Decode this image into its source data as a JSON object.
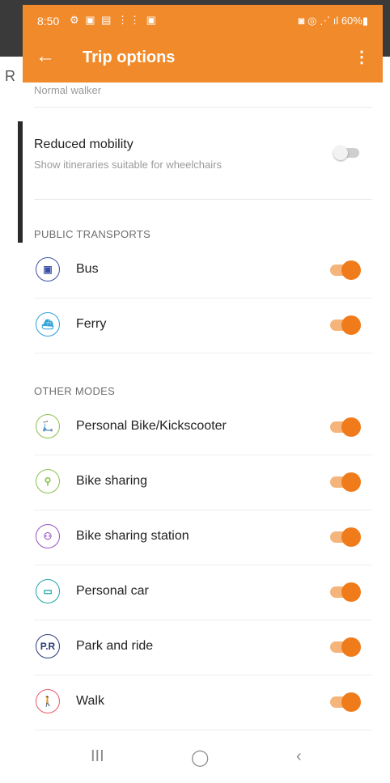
{
  "status_bar": {
    "time": "8:50",
    "left_icons": "⚙ ▣ ▤ ⋮⋮ ▣",
    "right_indicators": "◙ ◎ ⋰ ıl 60%▮"
  },
  "app_bar": {
    "title": "Trip options",
    "background_color": "#f08a2a"
  },
  "behind_app_letter": "R",
  "walker": {
    "label": "Normal walker"
  },
  "reduced_mobility": {
    "title": "Reduced mobility",
    "subtitle": "Show itineraries suitable for wheelchairs",
    "enabled": false
  },
  "public_transports": {
    "header": "PUBLIC TRANSPORTS",
    "items": [
      {
        "label": "Bus",
        "icon": "bus-icon",
        "icon_glyph": "▣",
        "color": "#3b4fa6",
        "enabled": true
      },
      {
        "label": "Ferry",
        "icon": "ferry-icon",
        "icon_glyph": "⛴",
        "color": "#2aa0d8",
        "enabled": true
      }
    ]
  },
  "other_modes": {
    "header": "OTHER MODES",
    "items": [
      {
        "label": "Personal Bike/Kickscooter",
        "icon": "bike-kickscooter-icon",
        "icon_glyph": "🛴",
        "color": "#8cc04a",
        "enabled": true
      },
      {
        "label": "Bike sharing",
        "icon": "bike-sharing-icon",
        "icon_glyph": "⚲",
        "color": "#8cc04a",
        "enabled": true
      },
      {
        "label": "Bike sharing station",
        "icon": "bike-station-icon",
        "icon_glyph": "⚇",
        "color": "#9a4fc4",
        "enabled": true
      },
      {
        "label": "Personal car",
        "icon": "car-icon",
        "icon_glyph": "▭",
        "color": "#1aa6a6",
        "enabled": true
      },
      {
        "label": "Park and ride",
        "icon": "park-and-ride-icon",
        "icon_glyph": "P.R",
        "color": "#2b3a78",
        "enabled": true
      },
      {
        "label": "Walk",
        "icon": "walk-icon",
        "icon_glyph": "🚶",
        "color": "#e55a6a",
        "enabled": true
      }
    ]
  },
  "nav_bar": {
    "recents": "III",
    "home": "◯",
    "back": "‹"
  },
  "accent_color": "#f07b1a"
}
